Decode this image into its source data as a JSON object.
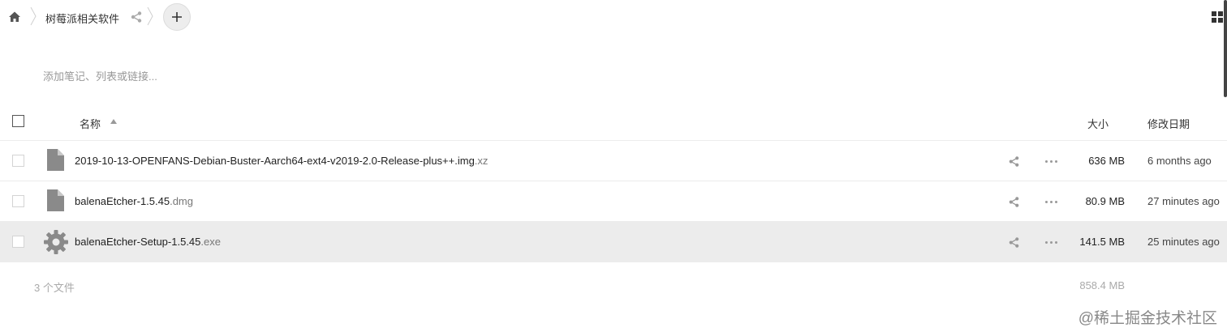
{
  "breadcrumb": {
    "home_icon": "home-icon",
    "folder_label": "树莓派相关软件",
    "share_icon": "share-icon"
  },
  "toolbar": {
    "add_icon": "plus-icon",
    "view_toggle_icon": "grid-icon"
  },
  "notes": {
    "placeholder": "添加笔记、列表或链接..."
  },
  "table": {
    "headers": {
      "name": "名称",
      "size": "大小",
      "modified": "修改日期"
    },
    "sort_icon": "sort-ascending-icon",
    "rows": [
      {
        "basename": "2019-10-13-OPENFANS-Debian-Buster-Aarch64-ext4-v2019-2.0-Release-plus++.img",
        "extension": ".xz",
        "icon": "file-icon",
        "size": "636 MB",
        "modified": "6 months ago",
        "selected": false
      },
      {
        "basename": "balenaEtcher-1.5.45",
        "extension": ".dmg",
        "icon": "file-icon",
        "size": "80.9 MB",
        "modified": "27 minutes ago",
        "selected": false
      },
      {
        "basename": "balenaEtcher-Setup-1.5.45",
        "extension": ".exe",
        "icon": "gear-icon",
        "size": "141.5 MB",
        "modified": "25 minutes ago",
        "selected": true
      }
    ]
  },
  "summary": {
    "count": "3 个文件",
    "total_size": "858.4 MB"
  },
  "watermark": "@稀土掘金技术社区",
  "colors": {
    "selected_row": "#ececec",
    "icon_gray": "#8a8a8a"
  }
}
